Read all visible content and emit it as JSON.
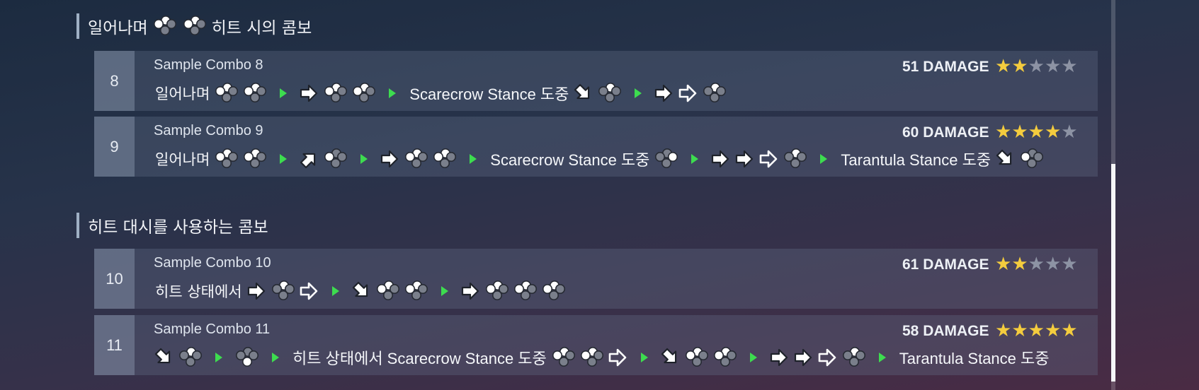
{
  "sections": [
    {
      "title_prefix": "일어나며",
      "title_suffix": "히트 시의 콤보"
    },
    {
      "title": "히트 대시를 사용하는 콤보"
    }
  ],
  "combos": [
    {
      "number": "8",
      "name": "Sample Combo 8",
      "damage": "51 DAMAGE",
      "rating": 2,
      "rating_max": 5,
      "sequence": [
        {
          "kind": "text",
          "text": "일어나며"
        },
        {
          "kind": "icon",
          "icon": "button-1-2-icon"
        },
        {
          "kind": "icon",
          "icon": "button-1-2-icon"
        },
        {
          "kind": "icon",
          "icon": "next-arrow-icon"
        },
        {
          "kind": "icon",
          "icon": "forward-hold-icon"
        },
        {
          "kind": "icon",
          "icon": "button-1-2-icon"
        },
        {
          "kind": "icon",
          "icon": "button-1-2-icon"
        },
        {
          "kind": "icon",
          "icon": "next-arrow-icon"
        },
        {
          "kind": "text",
          "text": "Scarecrow Stance 도중"
        },
        {
          "kind": "icon",
          "icon": "down-forward-hold-icon"
        },
        {
          "kind": "icon",
          "icon": "button-2-icon"
        },
        {
          "kind": "icon",
          "icon": "next-arrow-icon"
        },
        {
          "kind": "icon",
          "icon": "forward-hold-icon"
        },
        {
          "kind": "icon",
          "icon": "forward-tap-icon"
        },
        {
          "kind": "icon",
          "icon": "button-2-icon"
        }
      ]
    },
    {
      "number": "9",
      "name": "Sample Combo 9",
      "damage": "60 DAMAGE",
      "rating": 4,
      "rating_max": 5,
      "sequence": [
        {
          "kind": "text",
          "text": "일어나며"
        },
        {
          "kind": "icon",
          "icon": "button-1-2-icon"
        },
        {
          "kind": "icon",
          "icon": "button-1-2-icon"
        },
        {
          "kind": "icon",
          "icon": "next-arrow-icon"
        },
        {
          "kind": "icon",
          "icon": "up-forward-hold-icon"
        },
        {
          "kind": "icon",
          "icon": "button-1-icon"
        },
        {
          "kind": "icon",
          "icon": "next-arrow-icon"
        },
        {
          "kind": "icon",
          "icon": "forward-hold-icon"
        },
        {
          "kind": "icon",
          "icon": "button-1-2-icon"
        },
        {
          "kind": "icon",
          "icon": "button-1-2-icon"
        },
        {
          "kind": "icon",
          "icon": "next-arrow-icon"
        },
        {
          "kind": "text",
          "text": "Scarecrow Stance 도중"
        },
        {
          "kind": "icon",
          "icon": "button-4-icon"
        },
        {
          "kind": "icon",
          "icon": "next-arrow-icon"
        },
        {
          "kind": "icon",
          "icon": "forward-hold-icon"
        },
        {
          "kind": "icon",
          "icon": "forward-hold-icon"
        },
        {
          "kind": "icon",
          "icon": "forward-tap-icon"
        },
        {
          "kind": "icon",
          "icon": "button-2-icon"
        },
        {
          "kind": "icon",
          "icon": "next-arrow-icon"
        },
        {
          "kind": "text",
          "text": "Tarantula Stance 도중"
        },
        {
          "kind": "icon",
          "icon": "down-forward-hold-icon"
        },
        {
          "kind": "icon",
          "icon": "button-1-icon"
        }
      ]
    },
    {
      "number": "10",
      "name": "Sample Combo 10",
      "damage": "61 DAMAGE",
      "rating": 2,
      "rating_max": 5,
      "sequence": [
        {
          "kind": "text",
          "text": "히트 상태에서"
        },
        {
          "kind": "icon",
          "icon": "forward-hold-icon"
        },
        {
          "kind": "icon",
          "icon": "button-2-icon"
        },
        {
          "kind": "icon",
          "icon": "forward-tap-icon"
        },
        {
          "kind": "icon",
          "icon": "next-arrow-icon"
        },
        {
          "kind": "icon",
          "icon": "down-forward-hold-icon"
        },
        {
          "kind": "icon",
          "icon": "button-1-2-icon"
        },
        {
          "kind": "icon",
          "icon": "button-1-2-icon"
        },
        {
          "kind": "icon",
          "icon": "next-arrow-icon"
        },
        {
          "kind": "icon",
          "icon": "forward-hold-icon"
        },
        {
          "kind": "icon",
          "icon": "button-1-2-icon"
        },
        {
          "kind": "icon",
          "icon": "button-1-2-icon"
        },
        {
          "kind": "icon",
          "icon": "button-1-2-icon"
        }
      ]
    },
    {
      "number": "11",
      "name": "Sample Combo 11",
      "damage": "58 DAMAGE",
      "rating": 5,
      "rating_max": 5,
      "sequence": [
        {
          "kind": "icon",
          "icon": "down-forward-hold-icon"
        },
        {
          "kind": "icon",
          "icon": "button-2-icon"
        },
        {
          "kind": "icon",
          "icon": "next-arrow-icon"
        },
        {
          "kind": "icon",
          "icon": "button-3-icon"
        },
        {
          "kind": "icon",
          "icon": "next-arrow-icon"
        },
        {
          "kind": "text",
          "text": "히트 상태에서 Scarecrow Stance 도중"
        },
        {
          "kind": "icon",
          "icon": "button-1-2-icon"
        },
        {
          "kind": "icon",
          "icon": "button-1-2-icon"
        },
        {
          "kind": "icon",
          "icon": "forward-tap-icon"
        },
        {
          "kind": "icon",
          "icon": "next-arrow-icon"
        },
        {
          "kind": "icon",
          "icon": "down-forward-hold-icon"
        },
        {
          "kind": "icon",
          "icon": "button-1-2-icon"
        },
        {
          "kind": "icon",
          "icon": "button-1-2-icon"
        },
        {
          "kind": "icon",
          "icon": "next-arrow-icon"
        },
        {
          "kind": "icon",
          "icon": "forward-hold-icon"
        },
        {
          "kind": "icon",
          "icon": "forward-hold-icon"
        },
        {
          "kind": "icon",
          "icon": "forward-tap-icon"
        },
        {
          "kind": "icon",
          "icon": "button-2-icon"
        },
        {
          "kind": "icon",
          "icon": "next-arrow-icon"
        },
        {
          "kind": "text",
          "text": "Tarantula Stance 도중"
        }
      ]
    }
  ],
  "colors": {
    "star_on": "#f4cc3e",
    "star_off": "#8d93a4",
    "next_arrow": "#3ddc4f"
  }
}
